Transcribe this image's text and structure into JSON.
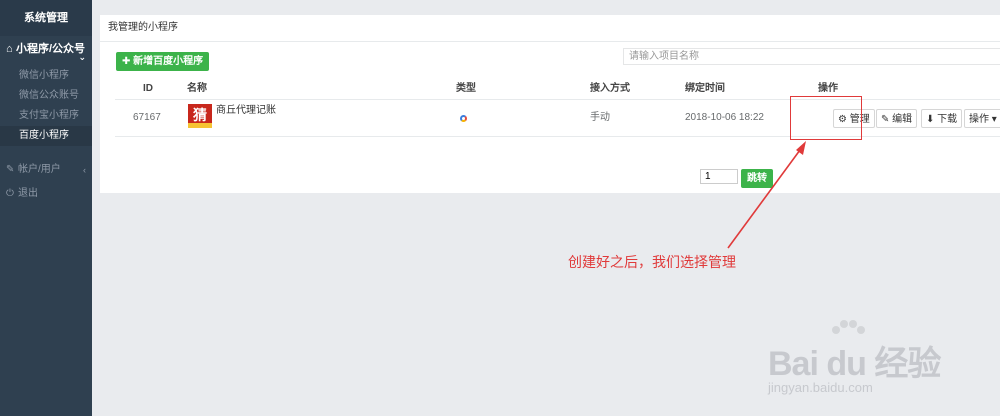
{
  "sidebar": {
    "title": "系统管理",
    "group": {
      "label": "小程序/公众号"
    },
    "sub_items": [
      {
        "label": "微信小程序"
      },
      {
        "label": "微信公众账号"
      },
      {
        "label": "支付宝小程序"
      },
      {
        "label": "百度小程序"
      }
    ],
    "items": [
      {
        "label": "帐户/用户",
        "icon": "edit-icon"
      },
      {
        "label": "退出",
        "icon": "power-icon"
      }
    ]
  },
  "panel": {
    "header": "我管理的小程序",
    "add_button": "✚ 新增百度小程序",
    "search_placeholder": "请输入项目名称"
  },
  "table": {
    "columns": [
      "ID",
      "名称",
      "类型",
      "接入方式",
      "绑定时间",
      "操作"
    ],
    "rows": [
      {
        "id": "67167",
        "logo_char": "猜",
        "name": "商丘代理记账",
        "type_icon": "baidu-icon",
        "access": "手动",
        "bind_time": "2018-10-06 18:22",
        "ops": {
          "manage": "⚙ 管理",
          "edit": "✎ 编辑",
          "download": "⬇ 下载",
          "more": "操作 ▾"
        }
      }
    ]
  },
  "pagination": {
    "page": "1",
    "jump": "跳转"
  },
  "annotation": "创建好之后，我们选择管理",
  "watermark": {
    "text": "Bai du 经验",
    "url": "jingyan.baidu.com"
  },
  "colors": {
    "sidebar_bg": "#2f4050",
    "accent_green": "#3cb34a",
    "annotation_red": "#e03a3a"
  }
}
